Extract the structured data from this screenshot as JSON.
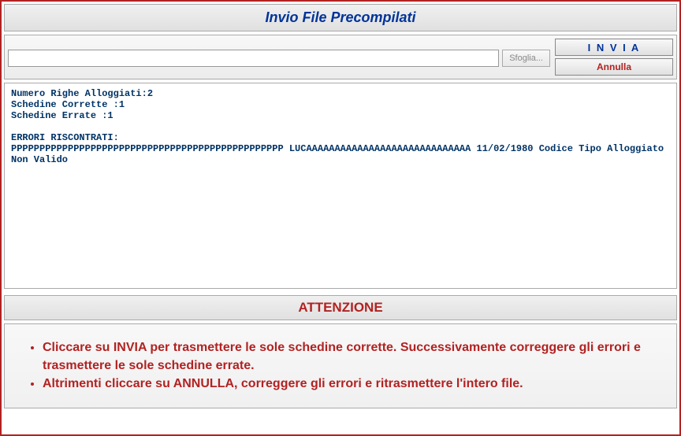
{
  "header": {
    "title": "Invio File Precompilati"
  },
  "upload": {
    "file_value": "",
    "browse_label": "Sfoglia...",
    "invia_label": "I N V I A",
    "annulla_label": "Annulla"
  },
  "log": {
    "text": "Numero Righe Alloggiati:2\nSchedine Corrette :1\nSchedine Errate :1\n\nERRORI RISCONTRATI:\nPPPPPPPPPPPPPPPPPPPPPPPPPPPPPPPPPPPPPPPPPPPPPPPP LUCAAAAAAAAAAAAAAAAAAAAAAAAAAAAA 11/02/1980 Codice Tipo Alloggiato Non Valido"
  },
  "attention": {
    "heading": "ATTENZIONE",
    "items": [
      "Cliccare su INVIA per trasmettere le sole schedine corrette. Successivamente correggere gli errori e trasmettere le sole schedine errate.",
      "Altrimenti cliccare su ANNULLA, correggere gli errori e ritrasmettere l'intero file."
    ]
  }
}
